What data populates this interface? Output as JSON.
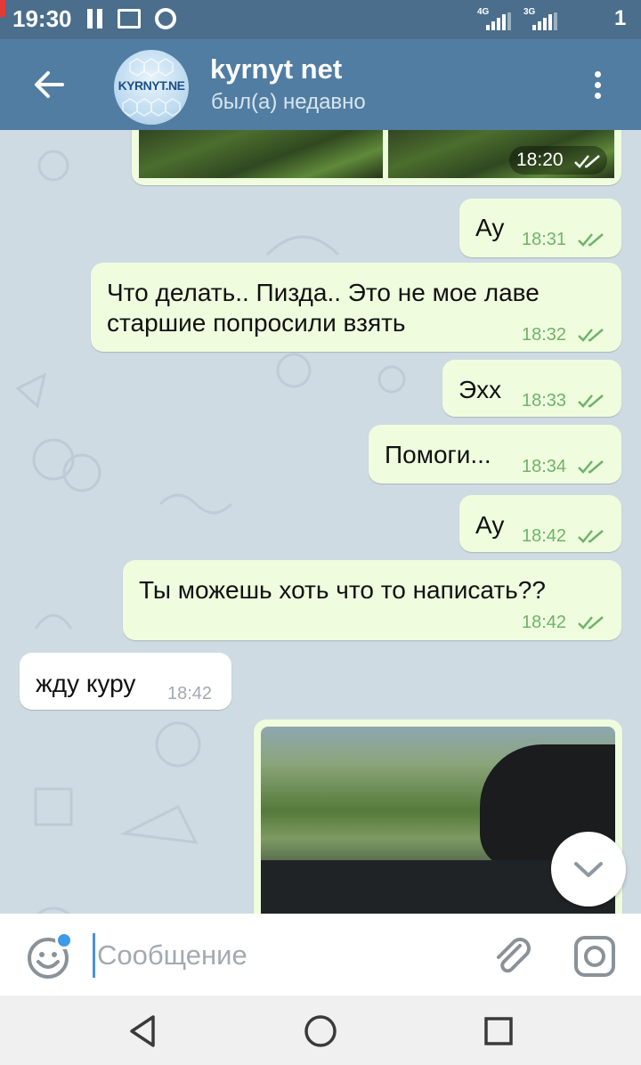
{
  "status_bar": {
    "time": "19:30",
    "signal1_tag": "4G",
    "signal2_tag": "3G",
    "battery_level": "1",
    "icons": [
      "pause-icon",
      "image-icon",
      "chrome-icon",
      "signal-icon",
      "battery-icon"
    ],
    "battery_color": "#e53935"
  },
  "header": {
    "title": "kyrnyt net",
    "status": "был(а) недавно",
    "avatar_text": "KYRNYT.NE",
    "icons": [
      "back-arrow-icon",
      "more-vert-icon"
    ]
  },
  "photo_message_top": {
    "time": "18:20",
    "read": true
  },
  "messages": [
    {
      "direction": "out",
      "text": "Ау",
      "time": "18:31",
      "read": true
    },
    {
      "direction": "out",
      "text_lines": [
        "Что делать.. Пизда.. Это не мое лаве",
        "старшие попросили взять"
      ],
      "time": "18:32",
      "read": true
    },
    {
      "direction": "out",
      "text": "Эхх",
      "time": "18:33",
      "read": true
    },
    {
      "direction": "out",
      "text": "Помоги...",
      "time": "18:34",
      "read": true
    },
    {
      "direction": "out",
      "text": "Ау",
      "time": "18:42",
      "read": true
    },
    {
      "direction": "out",
      "text": "Ты можешь хоть что то написать??",
      "time": "18:42",
      "read": true
    },
    {
      "direction": "in",
      "text": "жду куру",
      "time": "18:42"
    }
  ],
  "input": {
    "placeholder": "Сообщение",
    "value": ""
  },
  "colors": {
    "header_bg": "#517da2",
    "status_bar_bg": "#4a6e8c",
    "outgoing_bubble": "#effdde",
    "incoming_bubble": "#ffffff",
    "check_color": "#6eb36a",
    "chat_bg": "#cfdbe3"
  },
  "nav_bar": {
    "icons": [
      "back-triangle-icon",
      "home-circle-icon",
      "recents-square-icon"
    ]
  }
}
